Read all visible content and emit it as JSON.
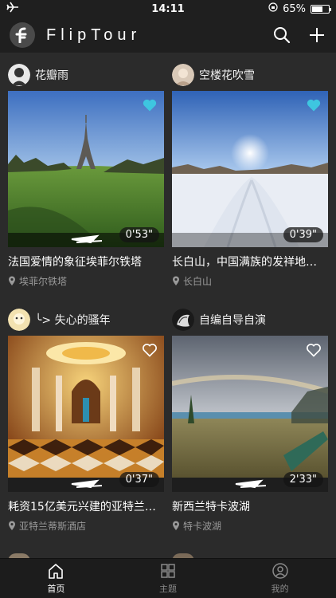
{
  "status": {
    "time": "14:11",
    "battery": "65%",
    "battery_level": 0.65
  },
  "header": {
    "title": "FlipTour"
  },
  "cards": [
    {
      "user": "花瓣雨",
      "title": "法国爱情的象征埃菲尔铁塔",
      "location": "埃菲尔铁塔",
      "duration": "0'53\"",
      "liked": true
    },
    {
      "user": "空楼花吹雪",
      "title": "长白山，中国满族的发祥地…",
      "location": "长白山",
      "duration": "0'39\"",
      "liked": true
    },
    {
      "user": "╰> 失心的骚年",
      "title": "耗资15亿美元兴建的亚特兰…",
      "location": "亚特兰蒂斯酒店",
      "duration": "0'37\"",
      "liked": false
    },
    {
      "user": "自编自导自演",
      "title": "新西兰特卡波湖",
      "location": "特卡波湖",
      "duration": "2'33\"",
      "liked": false
    }
  ],
  "tabs": [
    {
      "label": "首页",
      "icon": "home-icon",
      "active": true
    },
    {
      "label": "主题",
      "icon": "grid-icon",
      "active": false
    },
    {
      "label": "我的",
      "icon": "user-icon",
      "active": false
    }
  ],
  "colors": {
    "accent_like": "#3ec6e0",
    "background": "#2b2b2b",
    "bar": "#1f1f1f"
  }
}
